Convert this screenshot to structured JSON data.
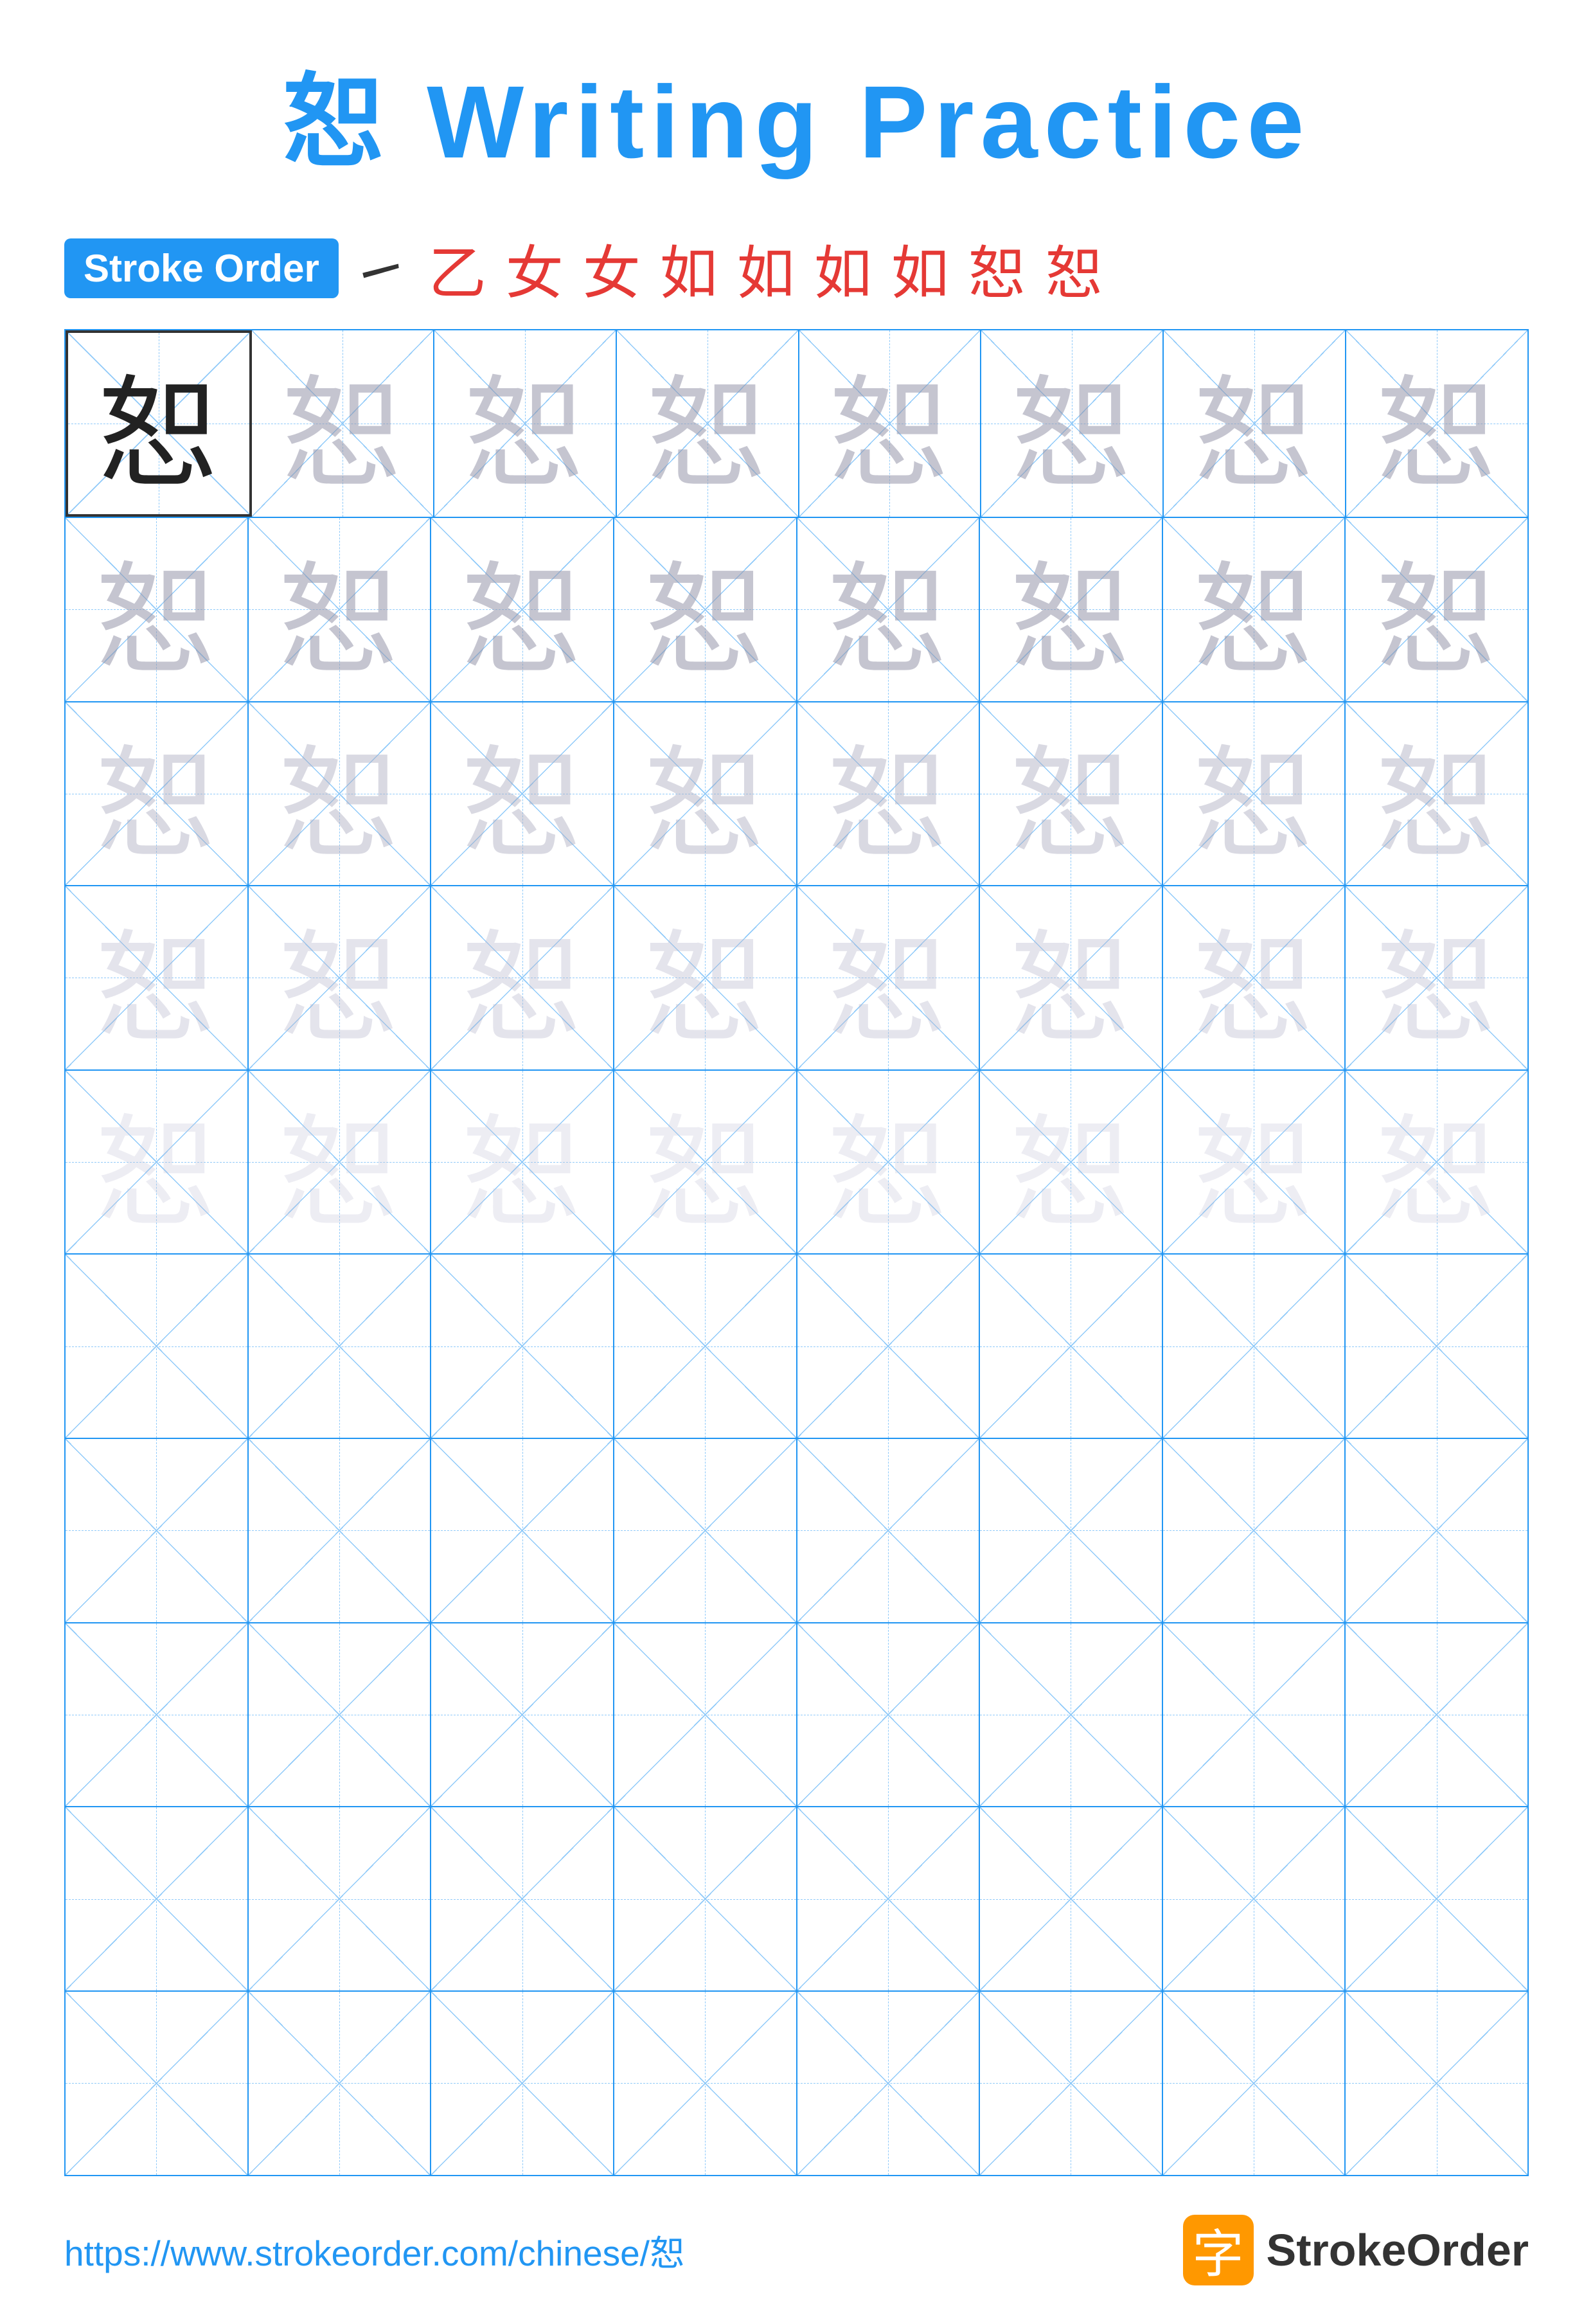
{
  "title": {
    "char": "恕",
    "text": " Writing Practice"
  },
  "stroke_order": {
    "badge_label": "Stroke Order",
    "chars": [
      "㇀",
      "乙",
      "女",
      "女",
      "如",
      "如",
      "如",
      "如",
      "恕",
      "恕"
    ]
  },
  "character": "恕",
  "grid": {
    "rows": 10,
    "cols": 8,
    "filled_rows": 5,
    "empty_rows": 5
  },
  "footer": {
    "url": "https://www.strokeorder.com/chinese/恕",
    "logo_icon": "字",
    "logo_text": "StrokeOrder"
  }
}
